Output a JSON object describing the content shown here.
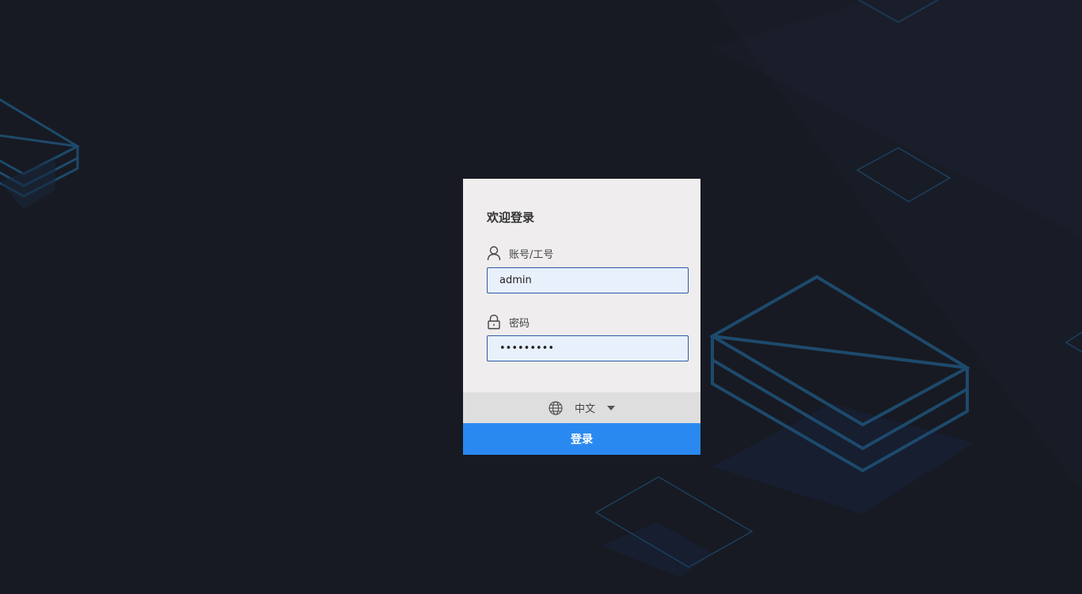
{
  "login": {
    "title": "欢迎登录",
    "account_label": "账号/工号",
    "account_value": "admin",
    "password_label": "密码",
    "password_value": "admin1234",
    "language": "中文",
    "submit_label": "登录"
  },
  "colors": {
    "background": "#171a22",
    "card": "#efeded",
    "accent": "#2a89f0",
    "decor_lines": "#1d4a6c"
  },
  "icons": {
    "account": "user-icon",
    "password": "lock-icon",
    "language": "globe-icon",
    "dropdown": "caret-down-icon"
  }
}
